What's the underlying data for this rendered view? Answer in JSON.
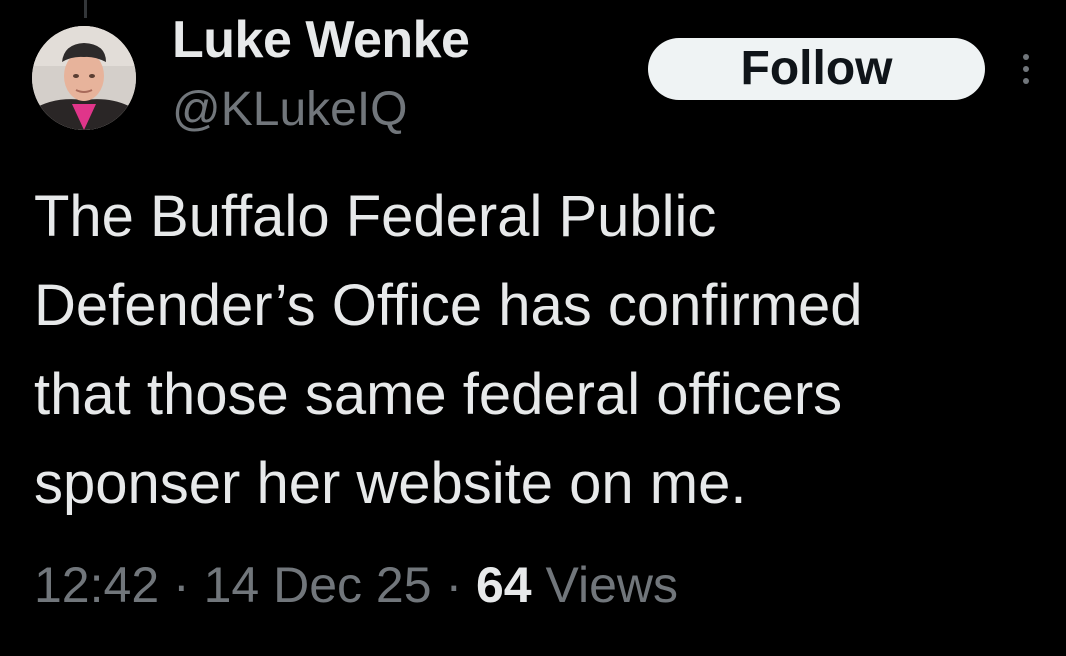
{
  "author": {
    "display_name": "Luke Wenke",
    "handle": "@KLukeIQ",
    "avatar": "profile-photo"
  },
  "actions": {
    "follow_label": "Follow",
    "more_icon": "more-horizontal-dots-icon"
  },
  "tweet": {
    "lines": [
      "The Buffalo Federal Public",
      "Defender’s Office has confirmed",
      "that those same federal officers",
      "sponser her website on me."
    ]
  },
  "meta": {
    "time": "12:42",
    "separator": "·",
    "date": "14 Dec 25",
    "views_count": "64",
    "views_label": "Views"
  },
  "colors": {
    "background": "#000000",
    "primary_text": "#e7e9ea",
    "secondary_text": "#71767b",
    "follow_bg": "#eff3f4",
    "follow_text": "#0f1419"
  }
}
